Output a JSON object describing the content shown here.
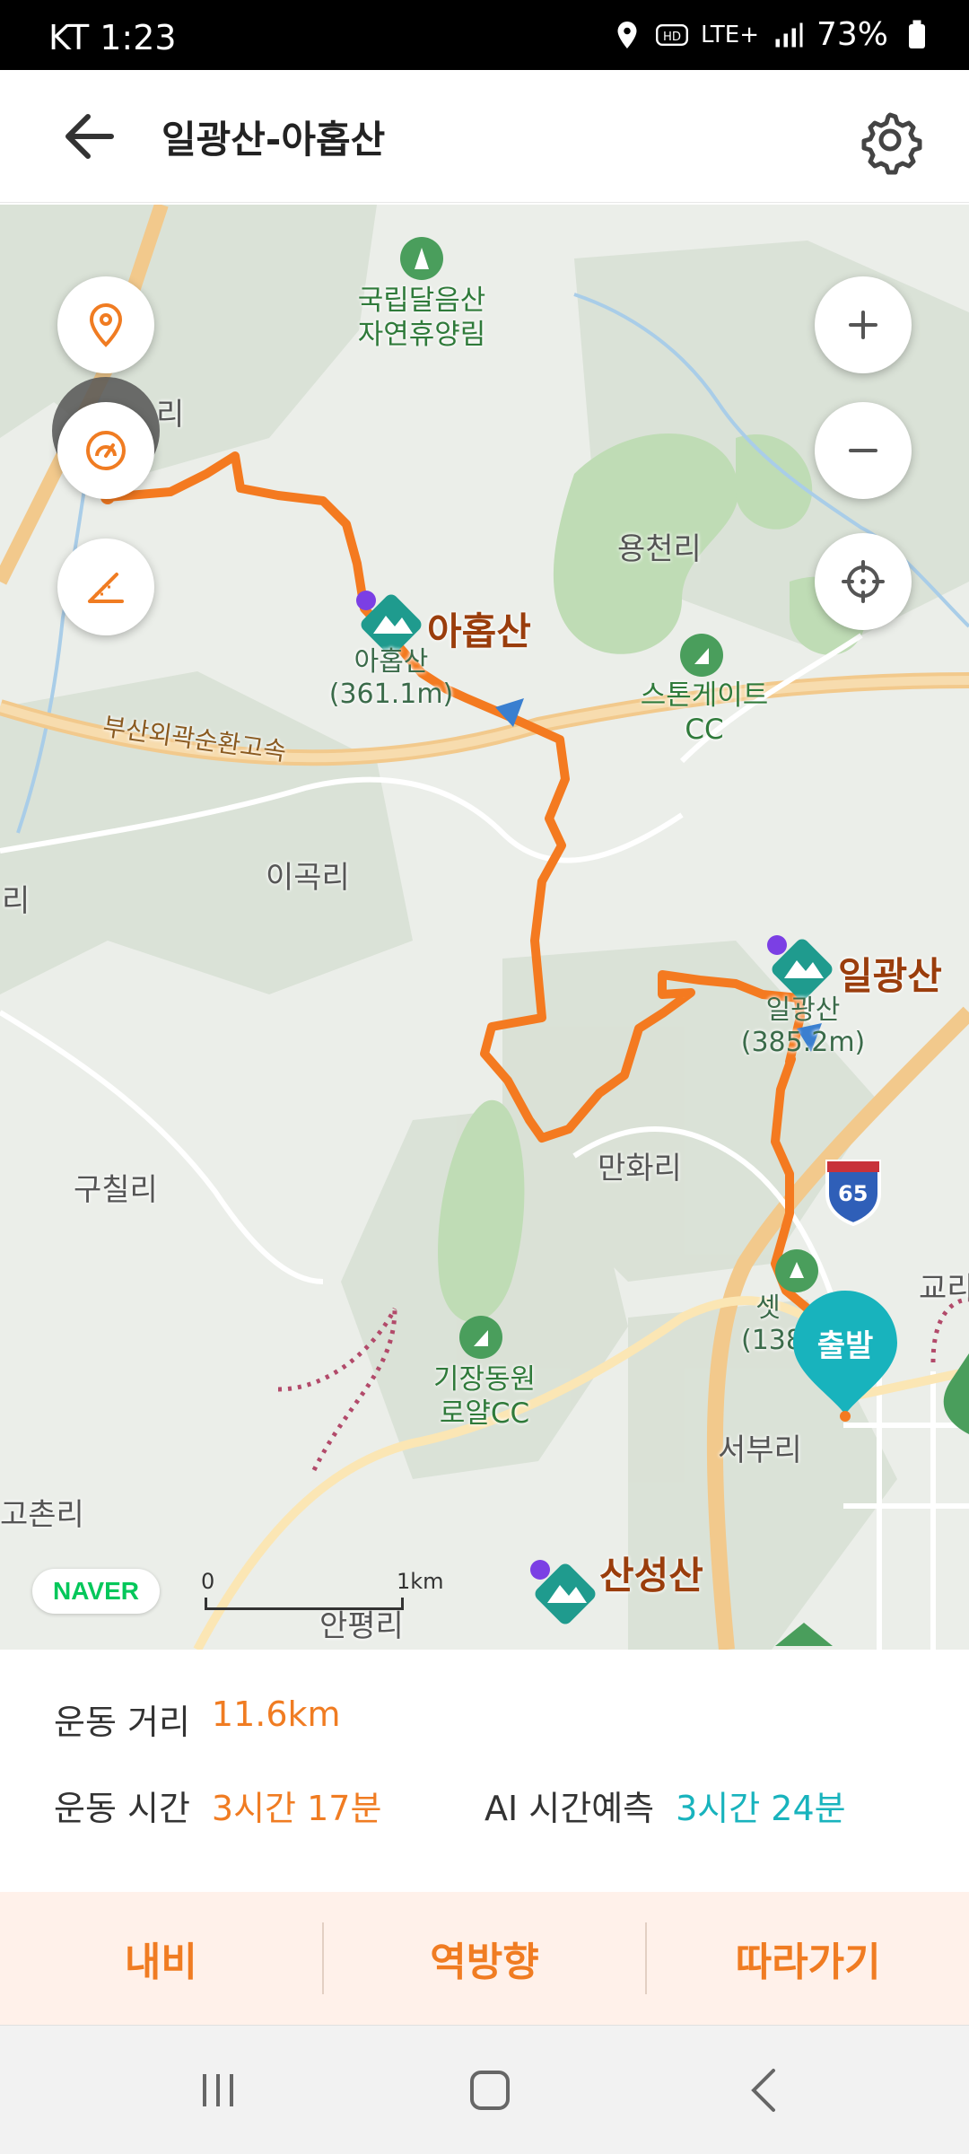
{
  "status_bar": {
    "carrier_time": "KT 1:23",
    "network": "LTE+",
    "battery": "73%"
  },
  "header": {
    "title": "일광산-아홉산"
  },
  "map": {
    "places": {
      "forest": "국립달음산\n자연휴양림",
      "yongcheon": "용천리",
      "ahop_name": "아홉산",
      "ahop_peak": "아홉산\n(361.1m)",
      "stonegate": "스톤게이트\nCC",
      "expressway": "부산외곽순환고속",
      "igok": "이곡리",
      "ilgwang_name": "일광산",
      "ilgwang_peak": "일광산\n(385.2m)",
      "manhwa": "만화리",
      "guchil": "구칠리",
      "gijang_cc": "기장동원\n로얄CC",
      "seobu": "서부리",
      "gochon": "고촌리",
      "sanseong": "산성산",
      "anpyeong": "안평리",
      "set_peak": "셋\n(138",
      "gyo": "교리",
      "ri_left": "리",
      "ri_left2": "리",
      "route_shield": "65"
    },
    "start_pin_label": "출발",
    "naver_logo": "NAVER",
    "scale": {
      "start": "0",
      "end": "1km"
    }
  },
  "stats": {
    "distance_label": "운동 거리",
    "distance_value": "11.6km",
    "time_label": "운동 시간",
    "time_value": "3시간 17분",
    "ai_label": "AI 시간예측",
    "ai_value": "3시간 24분"
  },
  "actions": {
    "navi": "내비",
    "reverse": "역방향",
    "follow": "따라가기"
  },
  "colors": {
    "route": "#f47a20",
    "accent": "#f07c22",
    "teal": "#18b3bd"
  }
}
